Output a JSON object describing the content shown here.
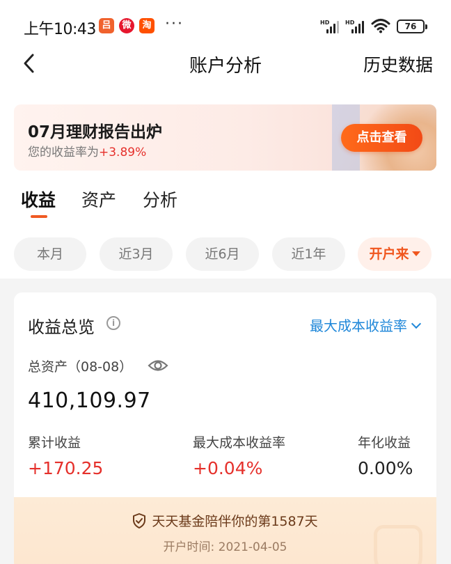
{
  "status_bar": {
    "time": "上午10:43",
    "apps": [
      {
        "name": "app-icon-1",
        "glyph": "吕",
        "color": "#f0622d"
      },
      {
        "name": "weibo-icon",
        "glyph": "微",
        "color": "#e6162d"
      },
      {
        "name": "taobao-icon",
        "glyph": "淘",
        "color": "#ff5000"
      }
    ],
    "more": "···",
    "battery": "76"
  },
  "header": {
    "title": "账户分析",
    "action": "历史数据"
  },
  "banner": {
    "title": "07月理财报告出炉",
    "subtitle_prefix": "您的收益率为",
    "rate": "+3.89%",
    "button": "点击查看"
  },
  "tabs": [
    {
      "label": "收益",
      "active": true
    },
    {
      "label": "资产",
      "active": false
    },
    {
      "label": "分析",
      "active": false
    }
  ],
  "periods": [
    {
      "label": "本月",
      "active": false
    },
    {
      "label": "近3月",
      "active": false
    },
    {
      "label": "近6月",
      "active": false
    },
    {
      "label": "近1年",
      "active": false
    },
    {
      "label": "开户来",
      "active": true
    }
  ],
  "overview": {
    "title": "收益总览",
    "info_glyph": "i",
    "mode": "最大成本收益率",
    "asset_label": "总资产（08-08）",
    "asset_value": "410,109.97",
    "metrics": [
      {
        "label": "累计收益",
        "value": "+170.25",
        "tone": "red"
      },
      {
        "label": "最大成本收益率",
        "value": "+0.04%",
        "tone": "red"
      },
      {
        "label": "年化收益",
        "value": "0.00%",
        "tone": "dark"
      }
    ]
  },
  "companion": {
    "message": "天天基金陪伴你的第1587天",
    "since_label": "开户时间: 2021-04-05"
  },
  "colors": {
    "accent": "#f0561e",
    "gain_red": "#e5302b",
    "link_blue": "#1f87d9"
  }
}
